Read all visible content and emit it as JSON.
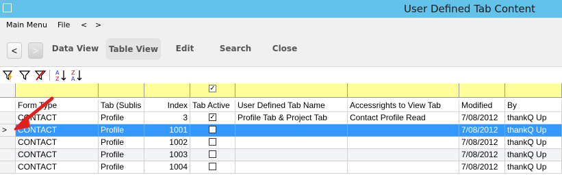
{
  "window": {
    "title": "User Defined Tab Content"
  },
  "menu": {
    "items": [
      "Main Menu",
      "File",
      "<",
      ">"
    ]
  },
  "ribbon": {
    "back_label": "<",
    "forward_label": ">",
    "data_view": "Data View",
    "table_view": "Table View",
    "edit": "Edit",
    "search": "Search",
    "close": "Close"
  },
  "toolbar": {
    "icons": [
      "filter-lightning-icon",
      "filter-icon",
      "clear-filter-icon",
      "sort-ascending-icon",
      "sort-descending-icon"
    ]
  },
  "grid": {
    "filter_row": {
      "tab_active_checked": true
    },
    "columns": [
      "Form Type",
      "Tab (Sublis",
      "Index",
      "Tab Active",
      "User Defined Tab Name",
      "Accessrights to View Tab",
      "Modified",
      "By"
    ],
    "current_row_marker": ">",
    "rows": [
      {
        "form_type": "CONTACT",
        "tab": "Profile",
        "index": "3",
        "active": true,
        "name": "Profile Tab & Project Tab",
        "access": "Contact Profile Read",
        "modified": "7/08/2012",
        "by": "thankQ Up"
      },
      {
        "form_type": "CONTACT",
        "tab": "Profile",
        "index": "1001",
        "active": false,
        "name": "",
        "access": "",
        "modified": "7/08/2012",
        "by": "thankQ Up"
      },
      {
        "form_type": "CONTACT",
        "tab": "Profile",
        "index": "1002",
        "active": false,
        "name": "",
        "access": "",
        "modified": "7/08/2012",
        "by": "thankQ Up"
      },
      {
        "form_type": "CONTACT",
        "tab": "Profile",
        "index": "1003",
        "active": false,
        "name": "",
        "access": "",
        "modified": "7/08/2012",
        "by": "thankQ Up"
      },
      {
        "form_type": "CONTACT",
        "tab": "Profile",
        "index": "1004",
        "active": false,
        "name": "",
        "access": "",
        "modified": "7/08/2012",
        "by": "thankQ Up"
      }
    ],
    "selected_row": 1
  },
  "colors": {
    "titlebar": "#63c2ea",
    "selection": "#3399ff",
    "filter_row": "#ffff99",
    "annotation_arrow": "#e0201b"
  }
}
